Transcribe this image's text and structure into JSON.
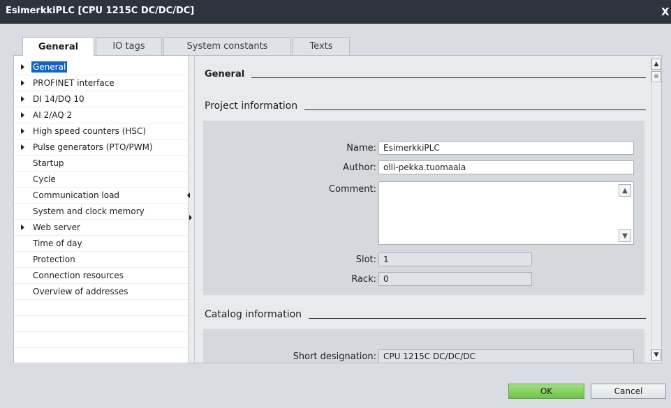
{
  "window": {
    "title": "EsimerkkiPLC [CPU 1215C DC/DC/DC]",
    "close_glyph": "X"
  },
  "tabs": [
    {
      "label": "General"
    },
    {
      "label": "IO tags"
    },
    {
      "label": "System constants"
    },
    {
      "label": "Texts"
    }
  ],
  "nav": {
    "items": [
      {
        "label": "General",
        "expandable": true,
        "selected": true
      },
      {
        "label": "PROFINET interface",
        "expandable": true
      },
      {
        "label": "DI 14/DQ 10",
        "expandable": true
      },
      {
        "label": "AI 2/AQ 2",
        "expandable": true
      },
      {
        "label": "High speed counters (HSC)",
        "expandable": true
      },
      {
        "label": "Pulse generators (PTO/PWM)",
        "expandable": true
      },
      {
        "label": "Startup",
        "expandable": false
      },
      {
        "label": "Cycle",
        "expandable": false
      },
      {
        "label": "Communication load",
        "expandable": false
      },
      {
        "label": "System and clock memory",
        "expandable": false
      },
      {
        "label": "Web server",
        "expandable": true
      },
      {
        "label": "Time of day",
        "expandable": false
      },
      {
        "label": "Protection",
        "expandable": false
      },
      {
        "label": "Connection resources",
        "expandable": false
      },
      {
        "label": "Overview of addresses",
        "expandable": false
      }
    ]
  },
  "content": {
    "heading": "General",
    "project_info": {
      "heading": "Project information",
      "name_label": "Name:",
      "name_value": "EsimerkkiPLC",
      "author_label": "Author:",
      "author_value": "olli-pekka.tuomaala",
      "comment_label": "Comment:",
      "comment_value": "",
      "slot_label": "Slot:",
      "slot_value": "1",
      "rack_label": "Rack:",
      "rack_value": "0"
    },
    "catalog_info": {
      "heading": "Catalog information",
      "short_designation_label": "Short designation:",
      "short_designation_value": "CPU 1215C DC/DC/DC"
    }
  },
  "buttons": {
    "ok": "OK",
    "cancel": "Cancel"
  },
  "colors": {
    "ok_green": "#7ccf58",
    "selection_blue": "#1565c0",
    "titlebar": "#2e343d"
  }
}
